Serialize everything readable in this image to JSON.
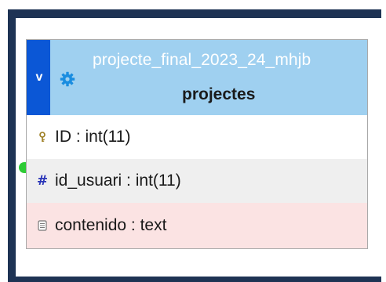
{
  "schema_card": {
    "collapse_toggle": "v",
    "database_name": "projecte_final_2023_24_mhjb",
    "table_name": "projectes",
    "fields": [
      {
        "icon": "key-icon",
        "label": "ID : int(11)"
      },
      {
        "icon": "hash-icon",
        "label": "id_usuari : int(11)"
      },
      {
        "icon": "text-field-icon",
        "label": "contenido : text"
      }
    ]
  },
  "colors": {
    "frame": "#1e3354",
    "header": "#9fd0f0",
    "collapse_bar": "#0b57d6",
    "gear": "#1a8de0",
    "relation_link": "#2ecb35",
    "row_alt": "#efefef",
    "row_text_field": "#fbe3e3"
  }
}
